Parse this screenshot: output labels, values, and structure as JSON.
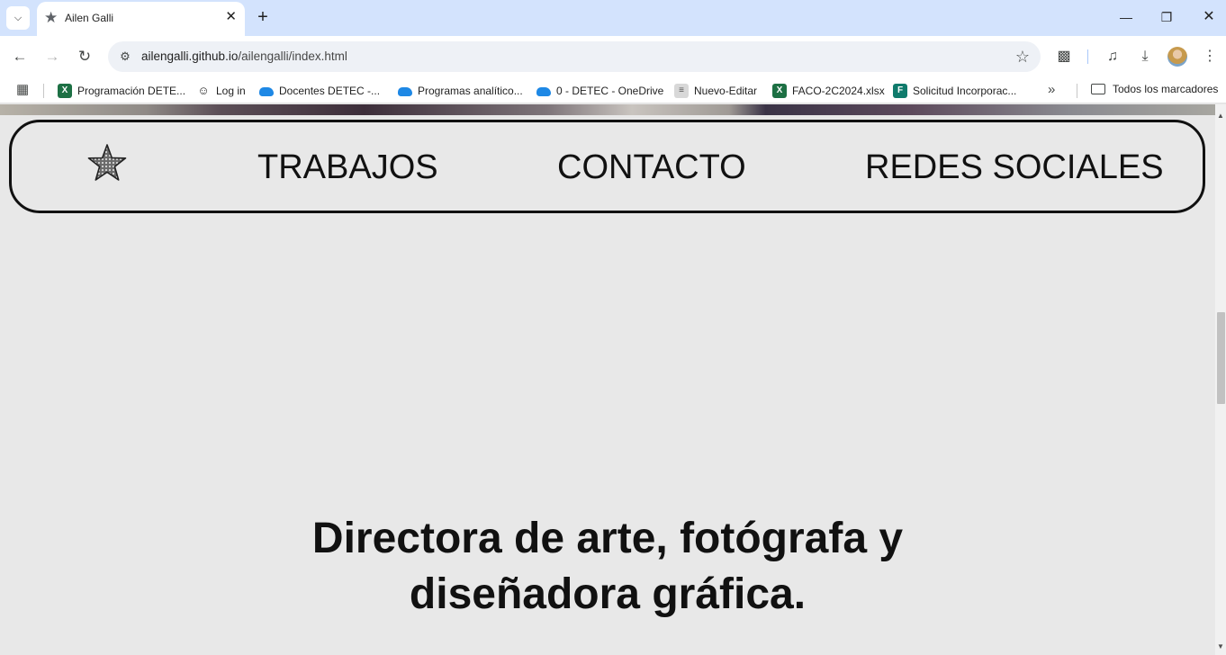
{
  "browser": {
    "tab": {
      "title": "Ailen Galli",
      "favicon": "star-icon"
    },
    "address": {
      "host": "ailengalli.github.io",
      "path": "/ailengalli/index.html"
    },
    "bookmarks": [
      {
        "label": "Programación DETE...",
        "icon": "excel-icon"
      },
      {
        "label": "Log in",
        "icon": "user-icon"
      },
      {
        "label": "Docentes DETEC -...",
        "icon": "onedrive-icon"
      },
      {
        "label": "Programas analítico...",
        "icon": "onedrive-icon"
      },
      {
        "label": "0 - DETEC - OneDrive",
        "icon": "onedrive-icon"
      },
      {
        "label": "Nuevo-Editar",
        "icon": "grid-icon"
      },
      {
        "label": "FACO-2C2024.xlsx",
        "icon": "excel-icon"
      },
      {
        "label": "Solicitud Incorporac...",
        "icon": "forms-icon"
      }
    ],
    "all_bookmarks": "Todos los marcadores"
  },
  "site": {
    "nav": {
      "logo": "star-icon",
      "links": [
        "TRABAJOS",
        "CONTACTO",
        "REDES SOCIALES"
      ]
    },
    "tagline_line1": "Directora de arte, fotógrafa y",
    "tagline_line2": "diseñadora gráfica."
  },
  "colors": {
    "chrome_tab_bar": "#d3e3fd",
    "page_background": "#e8e8e8",
    "text": "#111111"
  }
}
